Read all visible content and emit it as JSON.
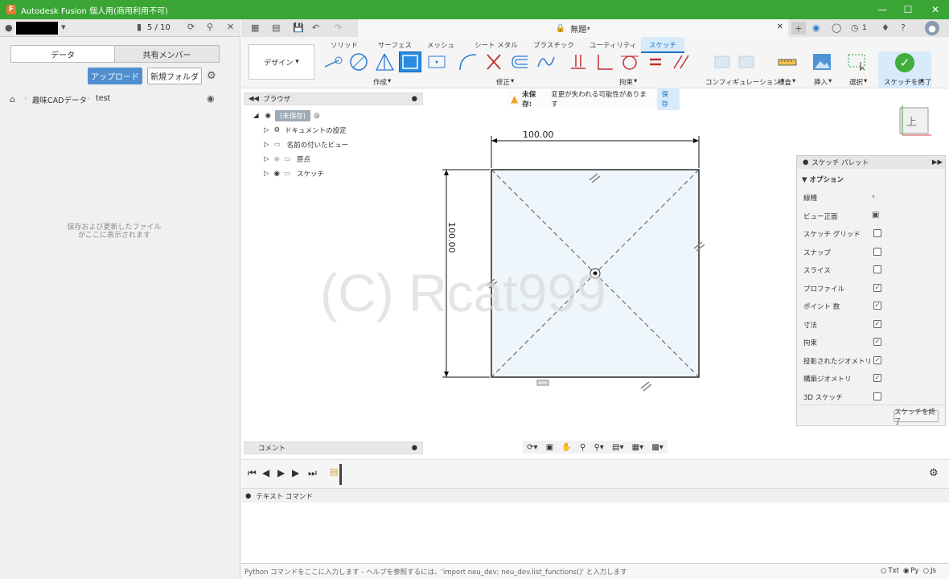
{
  "window": {
    "title": "Autodesk Fusion 個人用(商用利用不可)"
  },
  "topbar": {
    "job_count": "5 / 10",
    "doc_title": "無題*",
    "notification_count": "1"
  },
  "left": {
    "tabs": [
      "データ",
      "共有メンバー"
    ],
    "upload_label": "アップロード",
    "new_folder_label": "新規フォルダ",
    "breadcrumb": [
      "趣味CADデータ",
      "test"
    ],
    "empty_line1": "保存および更新したファイル",
    "empty_line2": "がここに表示されます"
  },
  "ribbon": {
    "design_label": "デザイン",
    "tabs": [
      "ソリッド",
      "サーフェス",
      "メッシュ",
      "シート メタル",
      "プラスチック",
      "ユーティリティ",
      "スケッチ"
    ],
    "groups": [
      "作成",
      "修正",
      "拘束",
      "コンフィギュレーション",
      "検査",
      "挿入",
      "選択",
      "スケッチを終了"
    ]
  },
  "browser": {
    "title": "ブラウザ",
    "root": "(未保存)",
    "items": [
      "ドキュメントの設定",
      "名前の付いたビュー",
      "原点",
      "スケッチ"
    ]
  },
  "warning": {
    "label": "未保存:",
    "message": "変更が失われる可能性があります",
    "save_label": "保存"
  },
  "canvas": {
    "dim_h": "100.00",
    "dim_v": "100.00",
    "watermark": "(C) Rcat999",
    "viewcube_label": "上"
  },
  "palette": {
    "title": "スケッチ パレット",
    "section": "オプション",
    "rows": [
      {
        "label": "線種",
        "checked": null
      },
      {
        "label": "ビュー正面",
        "checked": null
      },
      {
        "label": "スケッチ グリッド",
        "checked": false
      },
      {
        "label": "スナップ",
        "checked": false
      },
      {
        "label": "スライス",
        "checked": false
      },
      {
        "label": "プロファイル",
        "checked": true
      },
      {
        "label": "ポイント 数",
        "checked": true
      },
      {
        "label": "寸法",
        "checked": true
      },
      {
        "label": "拘束",
        "checked": true
      },
      {
        "label": "投影されたジオメトリ",
        "checked": true
      },
      {
        "label": "構築ジオメトリ",
        "checked": true
      },
      {
        "label": "3D スケッチ",
        "checked": false
      }
    ],
    "finish_label": "スケッチを終了"
  },
  "comment": {
    "title": "コメント"
  },
  "textcmd": {
    "title": "テキスト コマンド"
  },
  "python": {
    "placeholder": "Python コマンドをここに入力します - ヘルプを参照するには、'import neu_dev; neu_dev.list_functions()' と入力します",
    "modes": [
      "Txt",
      "Py",
      "Js"
    ],
    "selected_mode": "Py"
  },
  "colors": {
    "titlebar": "#3aa535",
    "accent": "#4f8fd0",
    "finish_green": "#3fae3a",
    "sketch_fill": "#eef6fc"
  }
}
